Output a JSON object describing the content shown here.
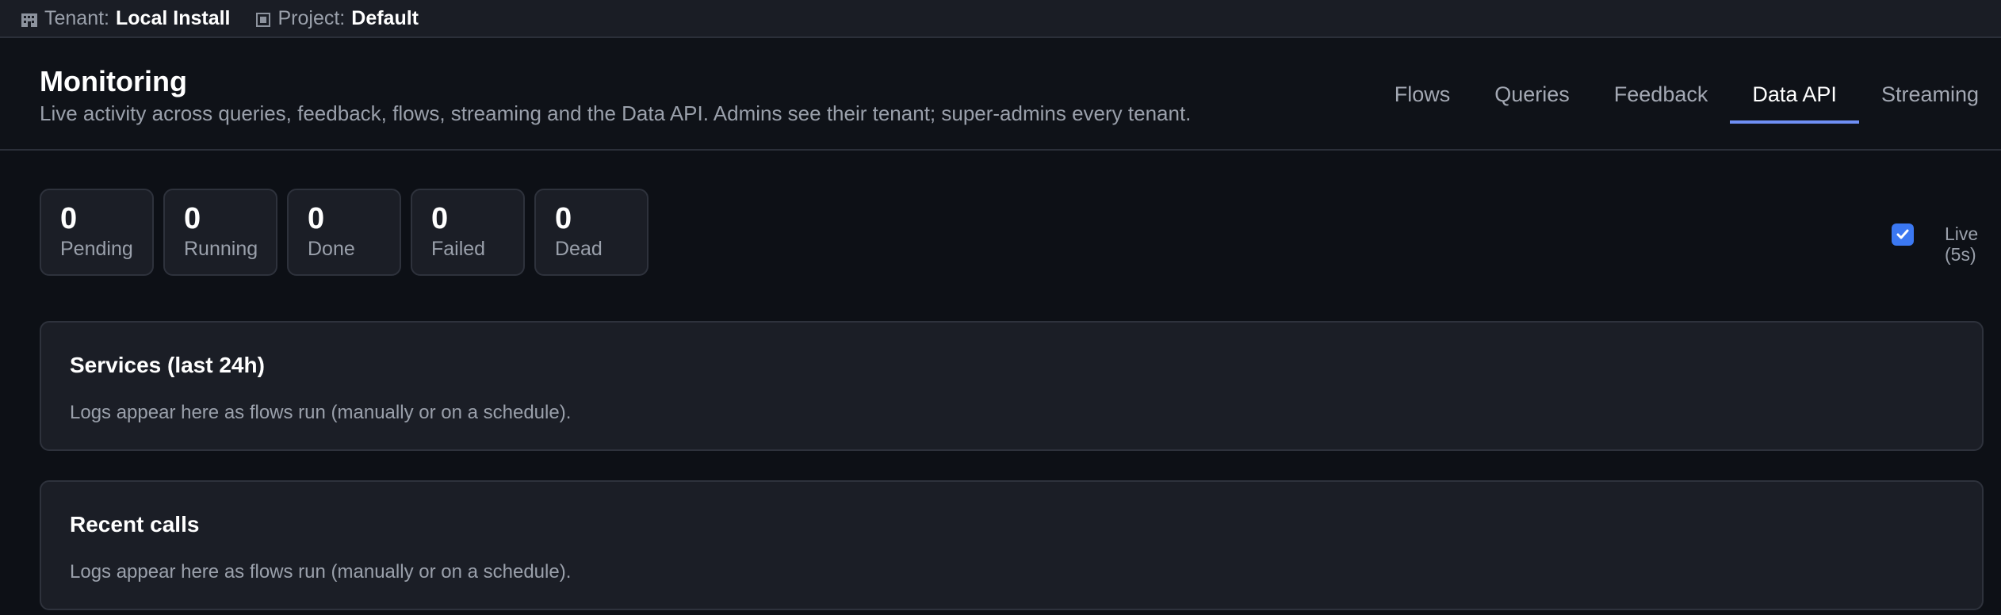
{
  "topbar": {
    "tenant_icon": "building-icon",
    "tenant_label": "Tenant:",
    "tenant_value": "Local Install",
    "project_icon": "square-icon",
    "project_label": "Project:",
    "project_value": "Default"
  },
  "header": {
    "title": "Monitoring",
    "subtitle": "Live activity across queries, feedback, flows, streaming and the Data API. Admins see their tenant; super-admins every tenant."
  },
  "tabs": [
    {
      "label": "Flows",
      "active": false
    },
    {
      "label": "Queries",
      "active": false
    },
    {
      "label": "Feedback",
      "active": false
    },
    {
      "label": "Data API",
      "active": true
    },
    {
      "label": "Streaming",
      "active": false
    }
  ],
  "stats": [
    {
      "value": "0",
      "label": "Pending"
    },
    {
      "value": "0",
      "label": "Running"
    },
    {
      "value": "0",
      "label": "Done"
    },
    {
      "value": "0",
      "label": "Failed"
    },
    {
      "value": "0",
      "label": "Dead"
    }
  ],
  "live": {
    "checked": true,
    "label_line1": "Live",
    "label_line2": "(5s)"
  },
  "panels": [
    {
      "title": "Services (last 24h)",
      "empty_text": "Logs appear here as flows run (manually or on a schedule)."
    },
    {
      "title": "Recent calls",
      "empty_text": "Logs appear here as flows run (manually or on a schedule)."
    }
  ],
  "colors": {
    "accent": "#6f8ff5",
    "checkbox": "#3b78f2",
    "background": "#0d1016",
    "card": "#1b1e26"
  }
}
